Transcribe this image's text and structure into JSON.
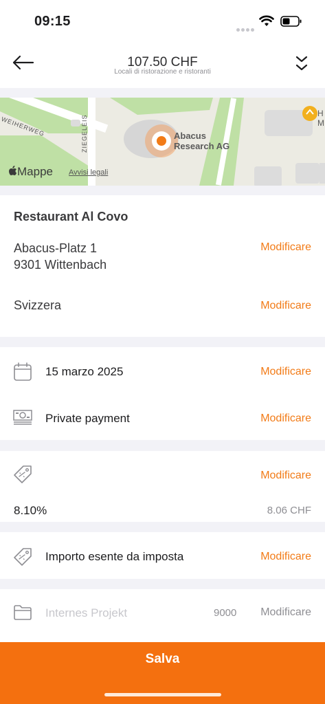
{
  "status_bar": {
    "time": "09:15"
  },
  "header": {
    "title": "107.50 CHF",
    "subtitle": "Locali di ristorazione e ristoranti"
  },
  "map": {
    "poi_label_line1": "Abacus",
    "poi_label_line2": "Research AG",
    "street_1": "WEIHERWEG",
    "street_2": "ZIEGELEIS",
    "right_poi_1": "H",
    "right_poi_2": "M",
    "brand": "Mappe",
    "legal": "Avvisi legali"
  },
  "location": {
    "name": "Restaurant Al Covo",
    "address_line1": "Abacus-Platz 1",
    "address_line2": "9301 Wittenbach",
    "country": "Svizzera",
    "edit_label": "Modificare"
  },
  "details": {
    "date": "15 marzo 2025",
    "payment": "Private payment",
    "edit_label": "Modificare"
  },
  "tax": {
    "rate": "8.10%",
    "amount": "8.06 CHF",
    "edit_label": "Modificare"
  },
  "exempt": {
    "label": "Importo esente da imposta",
    "edit_label": "Modificare"
  },
  "project": {
    "placeholder": "Internes Projekt",
    "code": "9000",
    "edit_label": "Modificare"
  },
  "footer": {
    "save_label": "Salva"
  },
  "colors": {
    "accent": "#f27b17",
    "save_bar": "#f4700f"
  }
}
